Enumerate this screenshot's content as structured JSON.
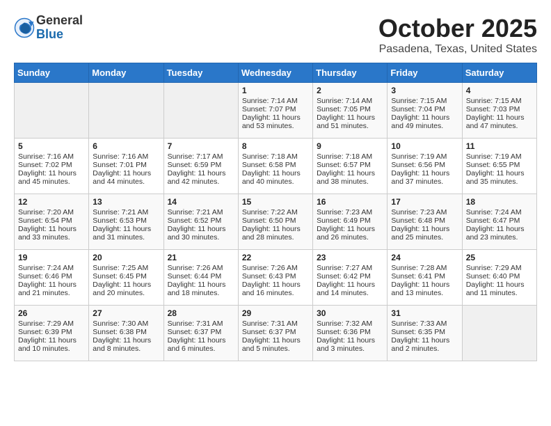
{
  "header": {
    "logo_general": "General",
    "logo_blue": "Blue",
    "month_title": "October 2025",
    "location": "Pasadena, Texas, United States"
  },
  "weekdays": [
    "Sunday",
    "Monday",
    "Tuesday",
    "Wednesday",
    "Thursday",
    "Friday",
    "Saturday"
  ],
  "weeks": [
    [
      {
        "day": "",
        "sunrise": "",
        "sunset": "",
        "daylight": ""
      },
      {
        "day": "",
        "sunrise": "",
        "sunset": "",
        "daylight": ""
      },
      {
        "day": "",
        "sunrise": "",
        "sunset": "",
        "daylight": ""
      },
      {
        "day": "1",
        "sunrise": "Sunrise: 7:14 AM",
        "sunset": "Sunset: 7:07 PM",
        "daylight": "Daylight: 11 hours and 53 minutes."
      },
      {
        "day": "2",
        "sunrise": "Sunrise: 7:14 AM",
        "sunset": "Sunset: 7:05 PM",
        "daylight": "Daylight: 11 hours and 51 minutes."
      },
      {
        "day": "3",
        "sunrise": "Sunrise: 7:15 AM",
        "sunset": "Sunset: 7:04 PM",
        "daylight": "Daylight: 11 hours and 49 minutes."
      },
      {
        "day": "4",
        "sunrise": "Sunrise: 7:15 AM",
        "sunset": "Sunset: 7:03 PM",
        "daylight": "Daylight: 11 hours and 47 minutes."
      }
    ],
    [
      {
        "day": "5",
        "sunrise": "Sunrise: 7:16 AM",
        "sunset": "Sunset: 7:02 PM",
        "daylight": "Daylight: 11 hours and 45 minutes."
      },
      {
        "day": "6",
        "sunrise": "Sunrise: 7:16 AM",
        "sunset": "Sunset: 7:01 PM",
        "daylight": "Daylight: 11 hours and 44 minutes."
      },
      {
        "day": "7",
        "sunrise": "Sunrise: 7:17 AM",
        "sunset": "Sunset: 6:59 PM",
        "daylight": "Daylight: 11 hours and 42 minutes."
      },
      {
        "day": "8",
        "sunrise": "Sunrise: 7:18 AM",
        "sunset": "Sunset: 6:58 PM",
        "daylight": "Daylight: 11 hours and 40 minutes."
      },
      {
        "day": "9",
        "sunrise": "Sunrise: 7:18 AM",
        "sunset": "Sunset: 6:57 PM",
        "daylight": "Daylight: 11 hours and 38 minutes."
      },
      {
        "day": "10",
        "sunrise": "Sunrise: 7:19 AM",
        "sunset": "Sunset: 6:56 PM",
        "daylight": "Daylight: 11 hours and 37 minutes."
      },
      {
        "day": "11",
        "sunrise": "Sunrise: 7:19 AM",
        "sunset": "Sunset: 6:55 PM",
        "daylight": "Daylight: 11 hours and 35 minutes."
      }
    ],
    [
      {
        "day": "12",
        "sunrise": "Sunrise: 7:20 AM",
        "sunset": "Sunset: 6:54 PM",
        "daylight": "Daylight: 11 hours and 33 minutes."
      },
      {
        "day": "13",
        "sunrise": "Sunrise: 7:21 AM",
        "sunset": "Sunset: 6:53 PM",
        "daylight": "Daylight: 11 hours and 31 minutes."
      },
      {
        "day": "14",
        "sunrise": "Sunrise: 7:21 AM",
        "sunset": "Sunset: 6:52 PM",
        "daylight": "Daylight: 11 hours and 30 minutes."
      },
      {
        "day": "15",
        "sunrise": "Sunrise: 7:22 AM",
        "sunset": "Sunset: 6:50 PM",
        "daylight": "Daylight: 11 hours and 28 minutes."
      },
      {
        "day": "16",
        "sunrise": "Sunrise: 7:23 AM",
        "sunset": "Sunset: 6:49 PM",
        "daylight": "Daylight: 11 hours and 26 minutes."
      },
      {
        "day": "17",
        "sunrise": "Sunrise: 7:23 AM",
        "sunset": "Sunset: 6:48 PM",
        "daylight": "Daylight: 11 hours and 25 minutes."
      },
      {
        "day": "18",
        "sunrise": "Sunrise: 7:24 AM",
        "sunset": "Sunset: 6:47 PM",
        "daylight": "Daylight: 11 hours and 23 minutes."
      }
    ],
    [
      {
        "day": "19",
        "sunrise": "Sunrise: 7:24 AM",
        "sunset": "Sunset: 6:46 PM",
        "daylight": "Daylight: 11 hours and 21 minutes."
      },
      {
        "day": "20",
        "sunrise": "Sunrise: 7:25 AM",
        "sunset": "Sunset: 6:45 PM",
        "daylight": "Daylight: 11 hours and 20 minutes."
      },
      {
        "day": "21",
        "sunrise": "Sunrise: 7:26 AM",
        "sunset": "Sunset: 6:44 PM",
        "daylight": "Daylight: 11 hours and 18 minutes."
      },
      {
        "day": "22",
        "sunrise": "Sunrise: 7:26 AM",
        "sunset": "Sunset: 6:43 PM",
        "daylight": "Daylight: 11 hours and 16 minutes."
      },
      {
        "day": "23",
        "sunrise": "Sunrise: 7:27 AM",
        "sunset": "Sunset: 6:42 PM",
        "daylight": "Daylight: 11 hours and 14 minutes."
      },
      {
        "day": "24",
        "sunrise": "Sunrise: 7:28 AM",
        "sunset": "Sunset: 6:41 PM",
        "daylight": "Daylight: 11 hours and 13 minutes."
      },
      {
        "day": "25",
        "sunrise": "Sunrise: 7:29 AM",
        "sunset": "Sunset: 6:40 PM",
        "daylight": "Daylight: 11 hours and 11 minutes."
      }
    ],
    [
      {
        "day": "26",
        "sunrise": "Sunrise: 7:29 AM",
        "sunset": "Sunset: 6:39 PM",
        "daylight": "Daylight: 11 hours and 10 minutes."
      },
      {
        "day": "27",
        "sunrise": "Sunrise: 7:30 AM",
        "sunset": "Sunset: 6:38 PM",
        "daylight": "Daylight: 11 hours and 8 minutes."
      },
      {
        "day": "28",
        "sunrise": "Sunrise: 7:31 AM",
        "sunset": "Sunset: 6:37 PM",
        "daylight": "Daylight: 11 hours and 6 minutes."
      },
      {
        "day": "29",
        "sunrise": "Sunrise: 7:31 AM",
        "sunset": "Sunset: 6:37 PM",
        "daylight": "Daylight: 11 hours and 5 minutes."
      },
      {
        "day": "30",
        "sunrise": "Sunrise: 7:32 AM",
        "sunset": "Sunset: 6:36 PM",
        "daylight": "Daylight: 11 hours and 3 minutes."
      },
      {
        "day": "31",
        "sunrise": "Sunrise: 7:33 AM",
        "sunset": "Sunset: 6:35 PM",
        "daylight": "Daylight: 11 hours and 2 minutes."
      },
      {
        "day": "",
        "sunrise": "",
        "sunset": "",
        "daylight": ""
      }
    ]
  ]
}
